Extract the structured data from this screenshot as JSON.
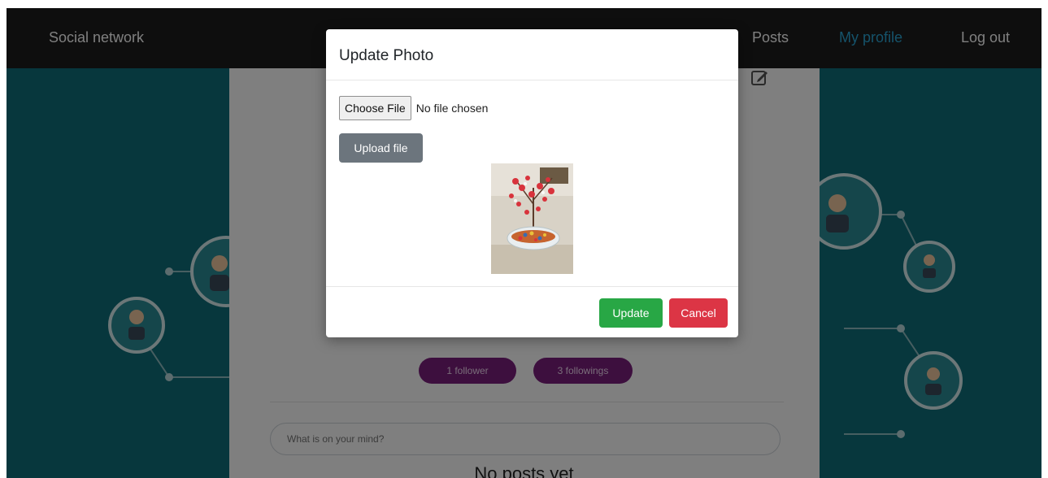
{
  "navbar": {
    "brand": "Social network",
    "links": [
      {
        "label": "Posts"
      },
      {
        "label": "My profile"
      },
      {
        "label": "Log out"
      }
    ],
    "active_color": "#2aa6d6"
  },
  "profile": {
    "followers_label": "1 follower",
    "followings_label": "3 followings",
    "post_placeholder": "What is on your mind?",
    "empty_posts": "No posts yet",
    "edit_icon": "edit-icon"
  },
  "modal": {
    "title": "Update Photo",
    "choose_file_label": "Choose File",
    "no_file_text": "No file chosen",
    "upload_label": "Upload file",
    "update_label": "Update",
    "cancel_label": "Cancel"
  },
  "colors": {
    "background": "#0f6f7a",
    "pill": "#7a1e7d",
    "update": "#28a745",
    "cancel": "#dc3545",
    "upload": "#6c757d"
  }
}
